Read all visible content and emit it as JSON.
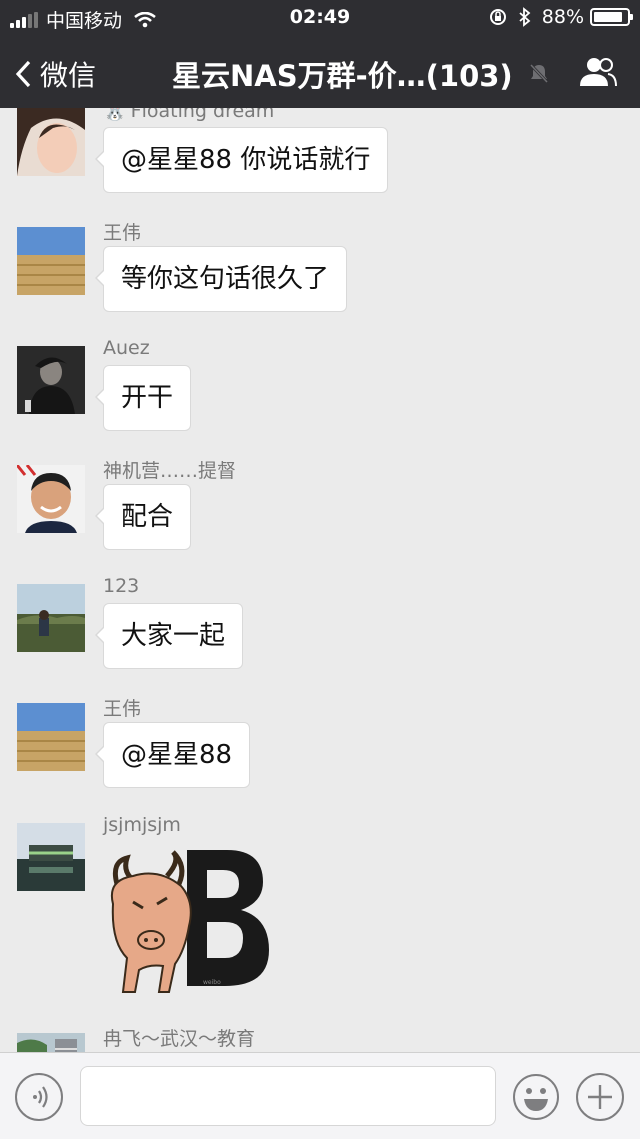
{
  "status_bar": {
    "carrier": "中国移动",
    "time": "02:49",
    "battery": "88%",
    "battery_level": 0.88
  },
  "nav": {
    "back_label": "微信",
    "title": "星云NAS万群-价…(103)"
  },
  "messages": [
    {
      "sender": "Floating dream",
      "text": "@星星88 你说话就行"
    },
    {
      "sender": "王伟",
      "text": "等你这句话很久了"
    },
    {
      "sender": "Auez",
      "text": "开干"
    },
    {
      "sender": "神机营……提督",
      "text": "配合"
    },
    {
      "sender": "123",
      "text": "大家一起"
    },
    {
      "sender": "王伟",
      "text": "@星星88"
    },
    {
      "sender": "jsjmjsjm",
      "sticker": "bull-B-sticker",
      "sticker_text": "B"
    },
    {
      "sender": "冉飞～武汉～教育"
    }
  ],
  "input_bar": {
    "placeholder": ""
  },
  "colors": {
    "nav_bg": "#2e2e32",
    "chat_bg": "#ebebeb",
    "bubble_bg": "#ffffff"
  }
}
